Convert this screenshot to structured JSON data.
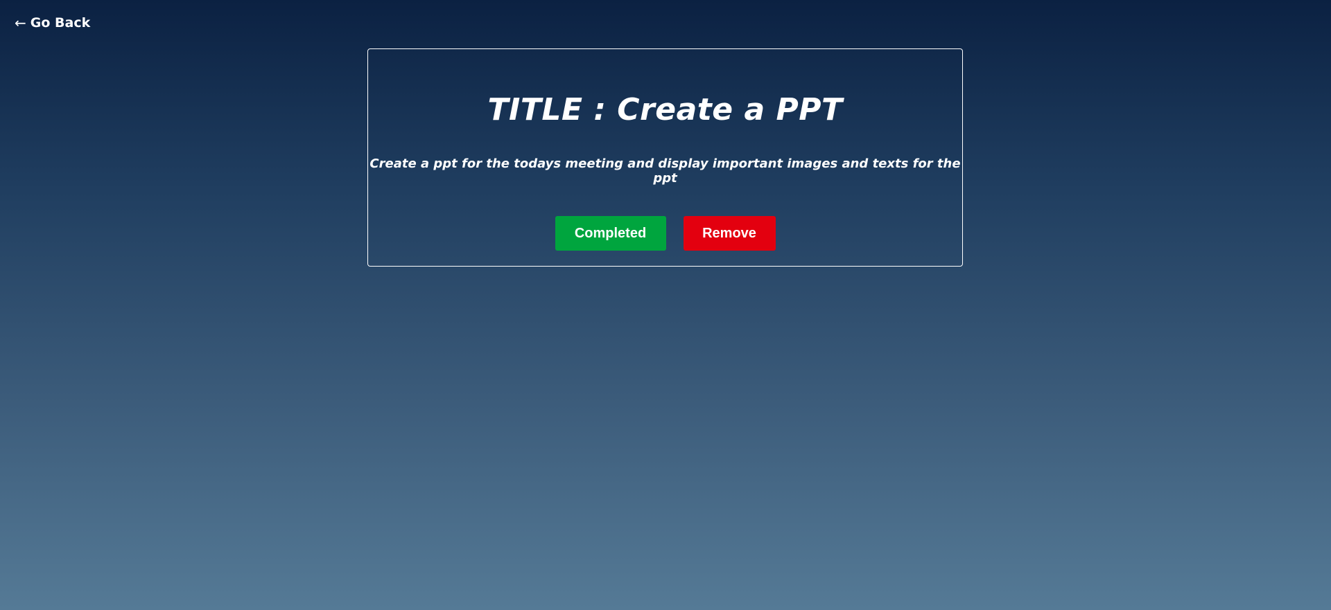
{
  "nav": {
    "back_icon": "left-arrow-icon",
    "back_label": "Go Back"
  },
  "task": {
    "title": "TITLE : Create a PPT",
    "description": "Create a ppt for the todays meeting and display important images and texts for the ppt"
  },
  "actions": {
    "completed_label": "Completed",
    "remove_label": "Remove",
    "completed_color": "#00a53e",
    "remove_color": "#e3000f"
  },
  "theme": {
    "background_top": "#0b2142",
    "background_bottom": "#557a96"
  }
}
